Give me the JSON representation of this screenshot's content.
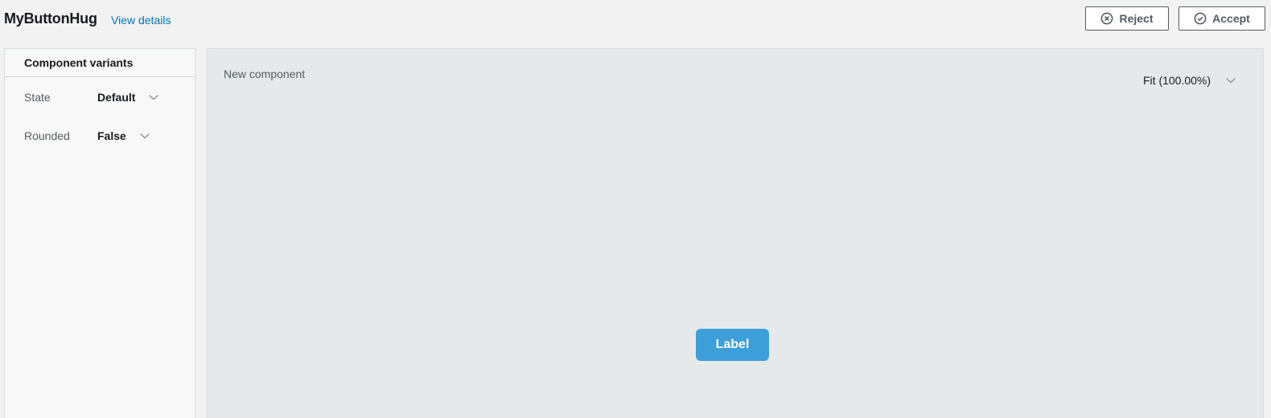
{
  "header": {
    "title": "MyButtonHug",
    "details_link": "View details",
    "reject_label": "Reject",
    "accept_label": "Accept",
    "reject_icon": "x-circle-icon",
    "accept_icon": "check-circle-icon"
  },
  "sidebar": {
    "title": "Component variants",
    "variants": [
      {
        "label": "State",
        "value": "Default"
      },
      {
        "label": "Rounded",
        "value": "False"
      }
    ]
  },
  "canvas": {
    "title": "New component",
    "zoom": "Fit (100.00%)",
    "preview_button_label": "Label"
  },
  "colors": {
    "link": "#0073bb",
    "preview_button": "#3d9fd9",
    "canvas_bg": "#e6e9ea",
    "page_bg": "#f1f2f1"
  }
}
